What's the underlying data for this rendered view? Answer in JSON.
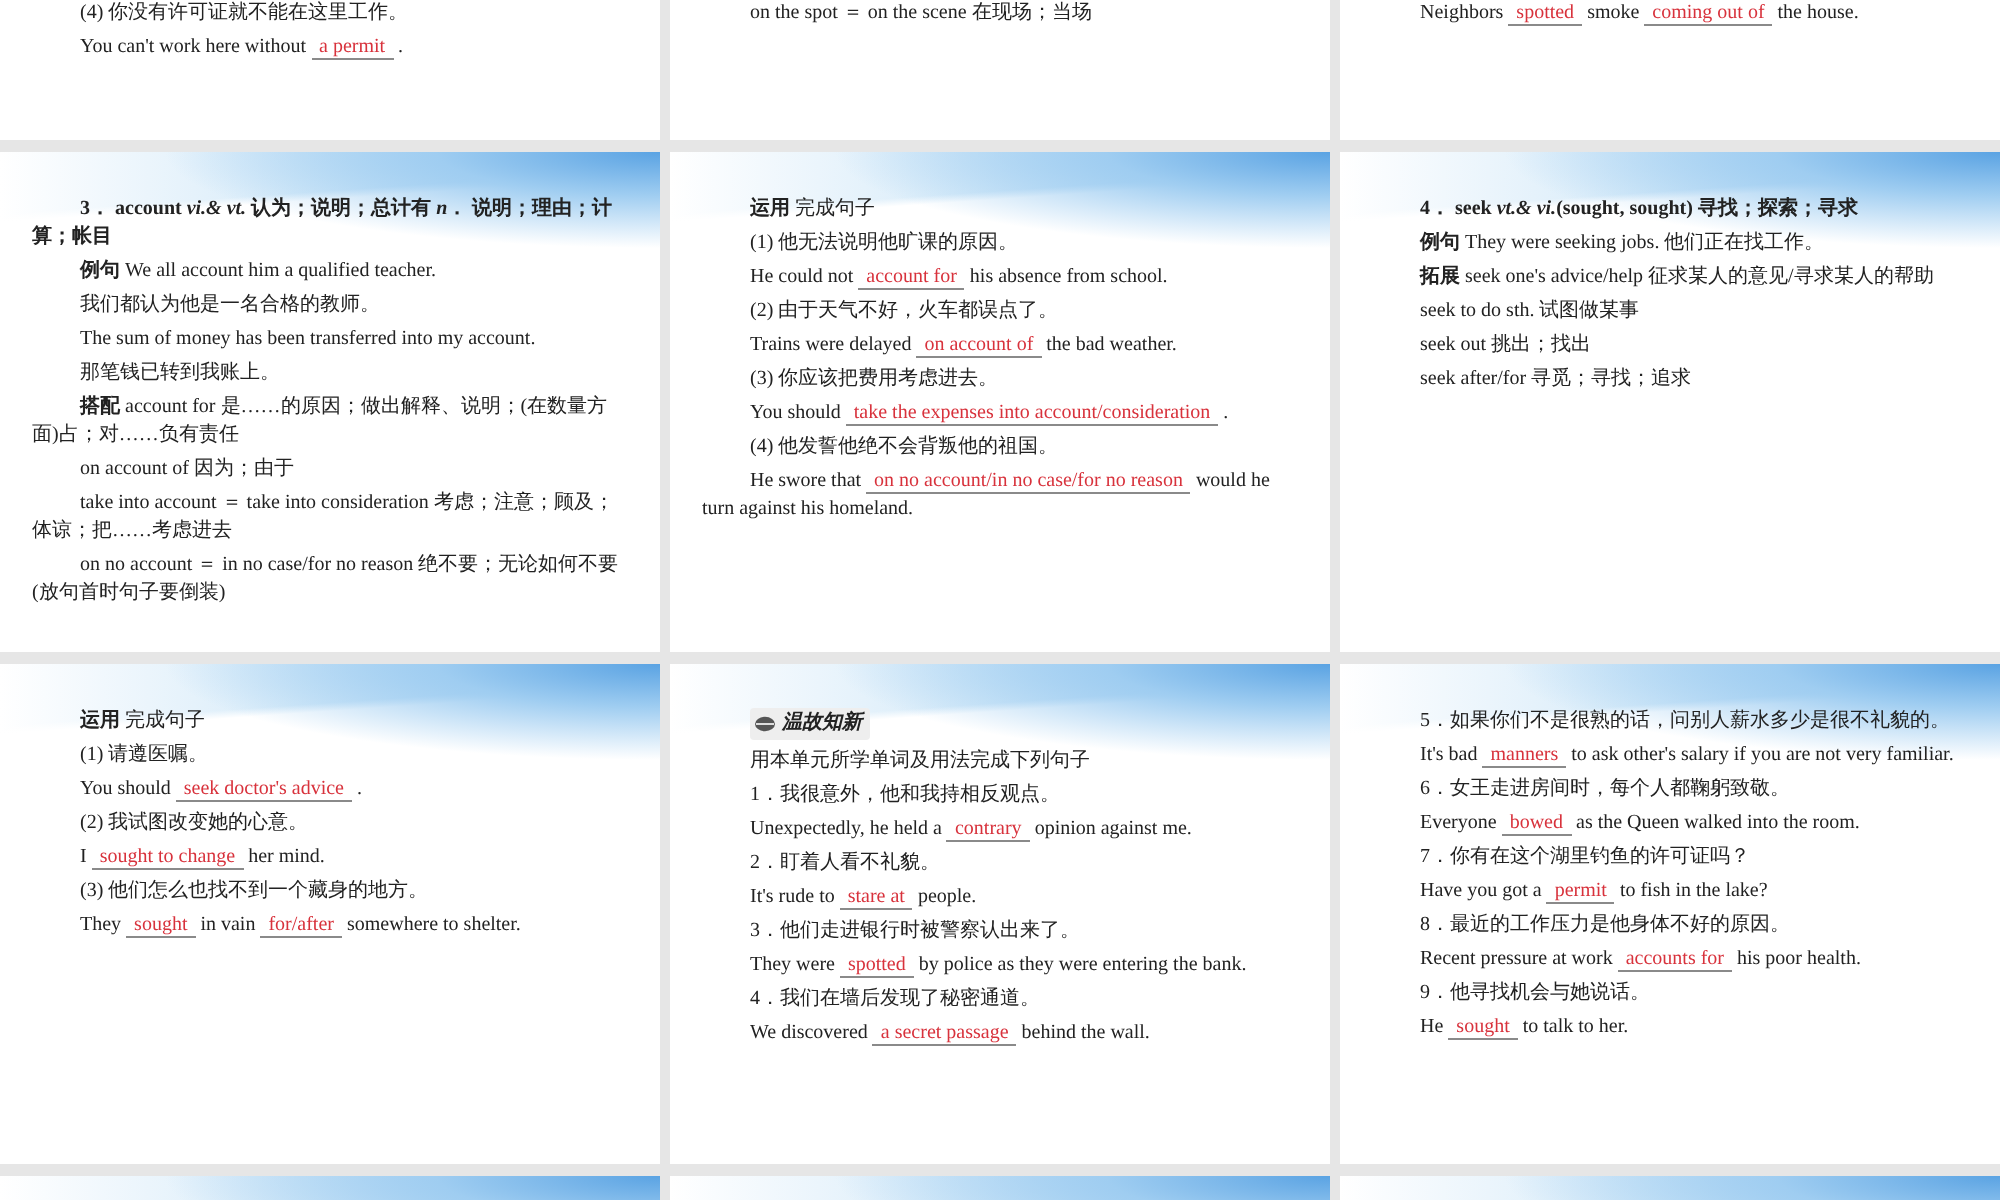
{
  "rows": [
    {
      "slides": [
        {
          "kind": "plain",
          "lines": [
            {
              "kind": "plain",
              "parts": [
                {
                  "kind": "text",
                  "text": "(4) 你没有许可证就不能在这里工作。"
                }
              ]
            },
            {
              "kind": "plain",
              "parts": [
                {
                  "kind": "text",
                  "text": "You can't work here without"
                },
                {
                  "kind": "answer",
                  "text": "a permit"
                },
                {
                  "kind": "text",
                  "text": "."
                }
              ]
            }
          ]
        },
        {
          "kind": "plain",
          "lines": [
            {
              "kind": "plain",
              "parts": [
                {
                  "kind": "text",
                  "text": "on the spot ＝ on the scene  在现场；当场"
                }
              ]
            }
          ]
        },
        {
          "kind": "plain",
          "lines": [
            {
              "kind": "plain",
              "parts": [
                {
                  "kind": "text",
                  "text": "Neighbors"
                },
                {
                  "kind": "answer",
                  "text": "spotted"
                },
                {
                  "kind": "text",
                  "text": "smoke"
                },
                {
                  "kind": "answer",
                  "text": "coming out of"
                },
                {
                  "kind": "text",
                  "text": "the house."
                }
              ]
            }
          ]
        }
      ]
    },
    {
      "slides": [
        {
          "kind": "swoosh",
          "lines": [
            {
              "kind": "heading",
              "parts": [
                {
                  "kind": "text",
                  "text": "3． account  *vi.& vt.* 认为；说明；总计有 *n*． 说明；理由；计算；帐目"
                }
              ]
            },
            {
              "kind": "plain",
              "parts": [
                {
                  "kind": "text",
                  "text": "**例句**  We all account him a qualified teacher."
                }
              ]
            },
            {
              "kind": "plain",
              "parts": [
                {
                  "kind": "text",
                  "text": "我们都认为他是一名合格的教师。"
                }
              ]
            },
            {
              "kind": "plain",
              "parts": [
                {
                  "kind": "text",
                  "text": "The sum of money has been transferred into my account."
                }
              ]
            },
            {
              "kind": "plain",
              "parts": [
                {
                  "kind": "text",
                  "text": "那笔钱已转到我账上。"
                }
              ]
            },
            {
              "kind": "plain",
              "parts": [
                {
                  "kind": "text",
                  "text": "**搭配**  account for  是……的原因；做出解释、说明；(在数量方面)占；对……负有责任"
                }
              ]
            },
            {
              "kind": "plain",
              "parts": [
                {
                  "kind": "text",
                  "text": "on account of  因为；由于"
                }
              ]
            },
            {
              "kind": "plain",
              "parts": [
                {
                  "kind": "text",
                  "text": "take into account ＝ take into consideration  考虑；注意；顾及；体谅；把……考虑进去"
                }
              ]
            },
            {
              "kind": "plain",
              "parts": [
                {
                  "kind": "text",
                  "text": "on no account ＝ in no case/for no reason  绝不要；无论如何不要(放句首时句子要倒装)"
                }
              ]
            }
          ]
        },
        {
          "kind": "swoosh",
          "lines": [
            {
              "kind": "plain",
              "parts": [
                {
                  "kind": "text",
                  "text": "**运用**  完成句子"
                }
              ]
            },
            {
              "kind": "plain",
              "parts": [
                {
                  "kind": "text",
                  "text": "(1) 他无法说明他旷课的原因。"
                }
              ]
            },
            {
              "kind": "plain",
              "parts": [
                {
                  "kind": "text",
                  "text": "He could not"
                },
                {
                  "kind": "answer",
                  "text": "account for"
                },
                {
                  "kind": "text",
                  "text": "his absence from school."
                }
              ]
            },
            {
              "kind": "plain",
              "parts": [
                {
                  "kind": "text",
                  "text": "(2) 由于天气不好，火车都误点了。"
                }
              ]
            },
            {
              "kind": "plain",
              "parts": [
                {
                  "kind": "text",
                  "text": "Trains were delayed"
                },
                {
                  "kind": "answer",
                  "text": "on account of"
                },
                {
                  "kind": "text",
                  "text": "the bad weather."
                }
              ]
            },
            {
              "kind": "plain",
              "parts": [
                {
                  "kind": "text",
                  "text": "(3) 你应该把费用考虑进去。"
                }
              ]
            },
            {
              "kind": "plain",
              "parts": [
                {
                  "kind": "text",
                  "text": "You should"
                },
                {
                  "kind": "answer",
                  "text": "take the expenses into account/consideration"
                },
                {
                  "kind": "text",
                  "text": "."
                }
              ]
            },
            {
              "kind": "plain",
              "parts": [
                {
                  "kind": "text",
                  "text": "(4) 他发誓他绝不会背叛他的祖国。"
                }
              ]
            },
            {
              "kind": "plain",
              "parts": [
                {
                  "kind": "text",
                  "text": "He swore that"
                },
                {
                  "kind": "answer",
                  "text": "on no account/in no case/for no reason"
                },
                {
                  "kind": "text",
                  "text": "would he"
                },
                {
                  "kind": "text",
                  "text": "turn against his homeland."
                }
              ]
            }
          ]
        },
        {
          "kind": "swoosh",
          "lines": [
            {
              "kind": "heading",
              "parts": [
                {
                  "kind": "text",
                  "text": "4． seek *vt.& vi.*(sought, sought) 寻找；探索；寻求"
                }
              ]
            },
            {
              "kind": "plain",
              "parts": [
                {
                  "kind": "text",
                  "text": "**例句**  They were seeking jobs. 他们正在找工作。"
                }
              ]
            },
            {
              "kind": "plain",
              "parts": [
                {
                  "kind": "text",
                  "text": "**拓展**  seek one's advice/help  征求某人的意见/寻求某人的帮助"
                }
              ]
            },
            {
              "kind": "plain",
              "parts": [
                {
                  "kind": "text",
                  "text": "seek to do sth. 试图做某事"
                }
              ]
            },
            {
              "kind": "plain",
              "parts": [
                {
                  "kind": "text",
                  "text": "seek out  挑出；找出"
                }
              ]
            },
            {
              "kind": "plain",
              "parts": [
                {
                  "kind": "text",
                  "text": "seek after/for  寻觅；寻找；追求"
                }
              ]
            }
          ]
        }
      ]
    },
    {
      "slides": [
        {
          "kind": "swoosh",
          "lines": [
            {
              "kind": "plain",
              "parts": [
                {
                  "kind": "text",
                  "text": "**运用**  完成句子"
                }
              ]
            },
            {
              "kind": "plain",
              "parts": [
                {
                  "kind": "text",
                  "text": "(1) 请遵医嘱。"
                }
              ]
            },
            {
              "kind": "plain",
              "parts": [
                {
                  "kind": "text",
                  "text": "You should"
                },
                {
                  "kind": "answer",
                  "text": "seek doctor's advice"
                },
                {
                  "kind": "text",
                  "text": "."
                }
              ]
            },
            {
              "kind": "plain",
              "parts": [
                {
                  "kind": "text",
                  "text": "(2) 我试图改变她的心意。"
                }
              ]
            },
            {
              "kind": "plain",
              "parts": [
                {
                  "kind": "text",
                  "text": "I"
                },
                {
                  "kind": "answer",
                  "text": "sought to change"
                },
                {
                  "kind": "text",
                  "text": "her mind."
                }
              ]
            },
            {
              "kind": "plain",
              "parts": [
                {
                  "kind": "text",
                  "text": "(3) 他们怎么也找不到一个藏身的地方。"
                }
              ]
            },
            {
              "kind": "plain",
              "parts": [
                {
                  "kind": "text",
                  "text": "They"
                },
                {
                  "kind": "answer",
                  "text": "sought"
                },
                {
                  "kind": "text",
                  "text": "in vain"
                },
                {
                  "kind": "answer",
                  "text": "for/after"
                },
                {
                  "kind": "text",
                  "text": "somewhere to shelter."
                }
              ]
            }
          ]
        },
        {
          "kind": "swoosh",
          "lines": [
            {
              "kind": "plain",
              "parts": [
                {
                  "kind": "badge",
                  "text": "温故知新"
                }
              ]
            },
            {
              "kind": "plain",
              "parts": [
                {
                  "kind": "text",
                  "text": "用本单元所学单词及用法完成下列句子"
                }
              ]
            },
            {
              "kind": "plain",
              "parts": [
                {
                  "kind": "text",
                  "text": "1．我很意外，他和我持相反观点。"
                }
              ]
            },
            {
              "kind": "plain",
              "parts": [
                {
                  "kind": "text",
                  "text": "Unexpectedly, he held a"
                },
                {
                  "kind": "answer",
                  "text": "contrary"
                },
                {
                  "kind": "text",
                  "text": "opinion against me."
                }
              ]
            },
            {
              "kind": "plain",
              "parts": [
                {
                  "kind": "text",
                  "text": "2．盯着人看不礼貌。"
                }
              ]
            },
            {
              "kind": "plain",
              "parts": [
                {
                  "kind": "text",
                  "text": "It's rude to"
                },
                {
                  "kind": "answer",
                  "text": "stare at"
                },
                {
                  "kind": "text",
                  "text": "people."
                }
              ]
            },
            {
              "kind": "plain",
              "parts": [
                {
                  "kind": "text",
                  "text": "3．他们走进银行时被警察认出来了。"
                }
              ]
            },
            {
              "kind": "plain",
              "parts": [
                {
                  "kind": "text",
                  "text": "They were"
                },
                {
                  "kind": "answer",
                  "text": "spotted"
                },
                {
                  "kind": "text",
                  "text": "by police as they were entering the bank."
                }
              ]
            },
            {
              "kind": "plain",
              "parts": [
                {
                  "kind": "text",
                  "text": "4．我们在墙后发现了秘密通道。"
                }
              ]
            },
            {
              "kind": "plain",
              "parts": [
                {
                  "kind": "text",
                  "text": "We discovered"
                },
                {
                  "kind": "answer",
                  "text": "a secret passage"
                },
                {
                  "kind": "text",
                  "text": "behind the wall."
                }
              ]
            }
          ]
        },
        {
          "kind": "swoosh",
          "lines": [
            {
              "kind": "plain",
              "parts": [
                {
                  "kind": "text",
                  "text": "5．如果你们不是很熟的话，问别人薪水多少是很不礼貌的。"
                }
              ]
            },
            {
              "kind": "plain",
              "parts": [
                {
                  "kind": "text",
                  "text": "It's bad"
                },
                {
                  "kind": "answer",
                  "text": "manners"
                },
                {
                  "kind": "text",
                  "text": "to ask other's salary if you are not very"
                },
                {
                  "kind": "text",
                  "text": "familiar."
                }
              ]
            },
            {
              "kind": "plain",
              "parts": [
                {
                  "kind": "text",
                  "text": "6．女王走进房间时，每个人都鞠躬致敬。"
                }
              ]
            },
            {
              "kind": "plain",
              "parts": [
                {
                  "kind": "text",
                  "text": "Everyone"
                },
                {
                  "kind": "answer",
                  "text": "bowed"
                },
                {
                  "kind": "text",
                  "text": "as the Queen walked into the room."
                }
              ]
            },
            {
              "kind": "plain",
              "parts": [
                {
                  "kind": "text",
                  "text": "7．你有在这个湖里钓鱼的许可证吗？"
                }
              ]
            },
            {
              "kind": "plain",
              "parts": [
                {
                  "kind": "text",
                  "text": "Have you got a"
                },
                {
                  "kind": "answer",
                  "text": "permit"
                },
                {
                  "kind": "text",
                  "text": "to fish in the lake?"
                }
              ]
            },
            {
              "kind": "plain",
              "parts": [
                {
                  "kind": "text",
                  "text": "8．最近的工作压力是他身体不好的原因。"
                }
              ]
            },
            {
              "kind": "plain",
              "parts": [
                {
                  "kind": "text",
                  "text": "Recent pressure at work"
                },
                {
                  "kind": "answer",
                  "text": "accounts for"
                },
                {
                  "kind": "text",
                  "text": "his poor health."
                }
              ]
            },
            {
              "kind": "plain",
              "parts": [
                {
                  "kind": "text",
                  "text": "9．他寻找机会与她说话。"
                }
              ]
            },
            {
              "kind": "plain",
              "parts": [
                {
                  "kind": "text",
                  "text": "He"
                },
                {
                  "kind": "answer",
                  "text": "sought"
                },
                {
                  "kind": "text",
                  "text": "to talk to her."
                }
              ]
            }
          ]
        }
      ]
    },
    {
      "slides": [
        {
          "kind": "swoosh"
        },
        {
          "kind": "swoosh"
        },
        {
          "kind": "swoosh"
        }
      ]
    }
  ]
}
